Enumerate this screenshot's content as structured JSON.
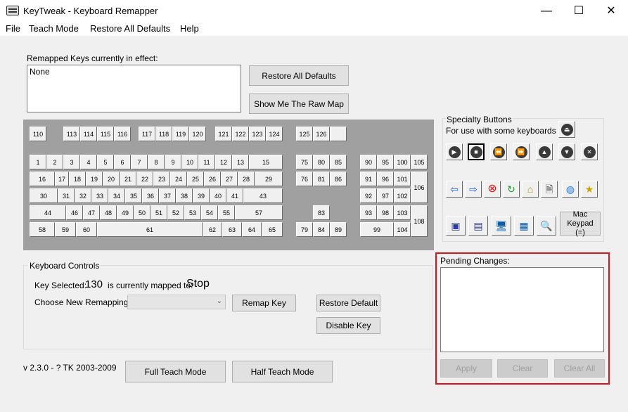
{
  "window": {
    "title": "KeyTweak -  Keyboard Remapper",
    "min": "—",
    "max": "☐",
    "close": "✕"
  },
  "menu": [
    "File",
    "Teach Mode",
    "Restore All Defaults",
    "Help"
  ],
  "remapped": {
    "label": "Remapped Keys currently in effect:",
    "value": "None"
  },
  "buttons": {
    "restore_all": "Restore All Defaults",
    "raw_map": "Show Me The Raw Map",
    "remap_key": "Remap Key",
    "restore_default": "Restore Default",
    "disable_key": "Disable Key",
    "full_teach": "Full Teach Mode",
    "half_teach": "Half Teach Mode",
    "apply": "Apply",
    "clear": "Clear",
    "clear_all": "Clear All"
  },
  "keys": {
    "fn_row": [
      "110",
      "113",
      "114",
      "115",
      "116",
      "117",
      "118",
      "119",
      "120",
      "121",
      "122",
      "123",
      "124",
      "125",
      "126"
    ],
    "row1": [
      "1",
      "2",
      "3",
      "4",
      "5",
      "6",
      "7",
      "8",
      "9",
      "10",
      "11",
      "12",
      "13",
      "15"
    ],
    "row2": [
      "16",
      "17",
      "18",
      "19",
      "20",
      "21",
      "22",
      "23",
      "24",
      "25",
      "26",
      "27",
      "28",
      "29"
    ],
    "row3": [
      "30",
      "31",
      "32",
      "33",
      "34",
      "35",
      "36",
      "37",
      "38",
      "39",
      "40",
      "41",
      "43"
    ],
    "row4": [
      "44",
      "46",
      "47",
      "48",
      "49",
      "50",
      "51",
      "52",
      "53",
      "54",
      "55",
      "57"
    ],
    "row5": [
      "58",
      "59",
      "60",
      "61",
      "62",
      "63",
      "64",
      "65"
    ],
    "nav": [
      "75",
      "80",
      "85",
      "76",
      "81",
      "86",
      "83",
      "79",
      "84",
      "89"
    ],
    "numpad": [
      "90",
      "95",
      "100",
      "105",
      "91",
      "96",
      "101",
      "106",
      "92",
      "97",
      "102",
      "93",
      "98",
      "103",
      "108",
      "99",
      "104"
    ]
  },
  "specialty": {
    "title": "Specialty Buttons",
    "subtitle": "For use with some keyboards",
    "mac_keypad": "Mac Keypad (=)"
  },
  "controls": {
    "group_label": "Keyboard Controls",
    "key_selected_label": "Key Selected:",
    "key_selected_value": "130",
    "mapped_to_label": "is currently mapped to:",
    "mapped_to_value": "Stop",
    "choose_label": "Choose New Remapping",
    "select_value": ""
  },
  "pending": {
    "label": "Pending Changes:"
  },
  "version": "v 2.3.0 - ? TK 2003-2009"
}
